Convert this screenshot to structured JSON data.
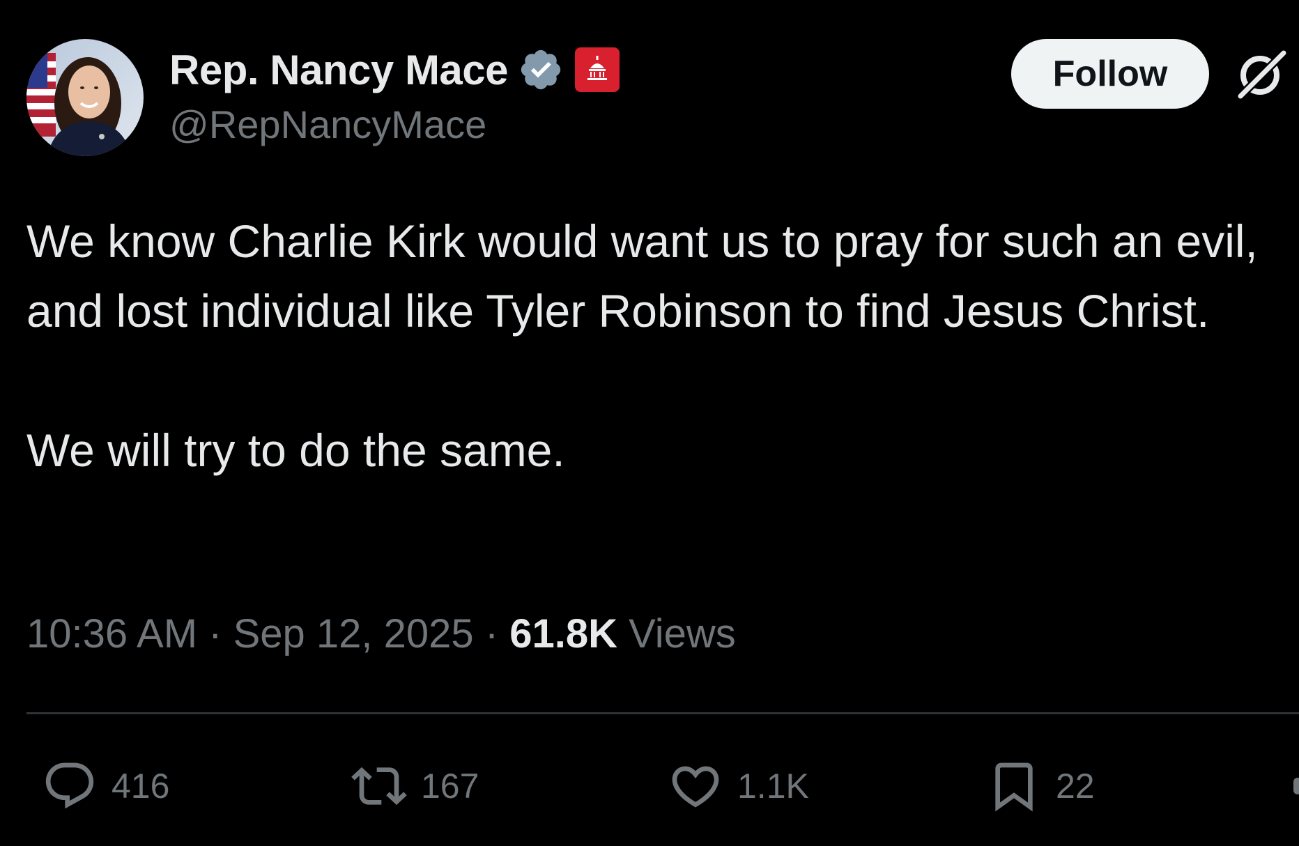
{
  "header": {
    "display_name": "Rep. Nancy Mace",
    "handle": "@RepNancyMace",
    "follow_label": "Follow",
    "avatar_icon": "avatar-photo",
    "verified_icon": "verified-badge-icon",
    "affiliation_icon": "us-capitol-badge-icon",
    "grok_icon": "grok-icon"
  },
  "tweet": {
    "paragraphs": [
      "We know Charlie Kirk would want us to pray for such an evil, and lost individual like Tyler Robinson to find Jesus Christ.",
      "We will try to do the same."
    ]
  },
  "meta": {
    "time": "10:36 AM",
    "separator": " · ",
    "date": "Sep 12, 2025",
    "views_count": "61.8K",
    "views_label": " Views"
  },
  "actions": {
    "reply_count": "416",
    "repost_count": "167",
    "like_count": "1.1K",
    "bookmark_count": "22"
  },
  "colors": {
    "background": "#000000",
    "primary_text": "#e7e9ea",
    "secondary_text": "#71767b",
    "divider": "#2f3336",
    "verified_badge": "#829aab",
    "affiliation_badge": "#d8202f",
    "follow_button_bg": "#eff3f4"
  }
}
